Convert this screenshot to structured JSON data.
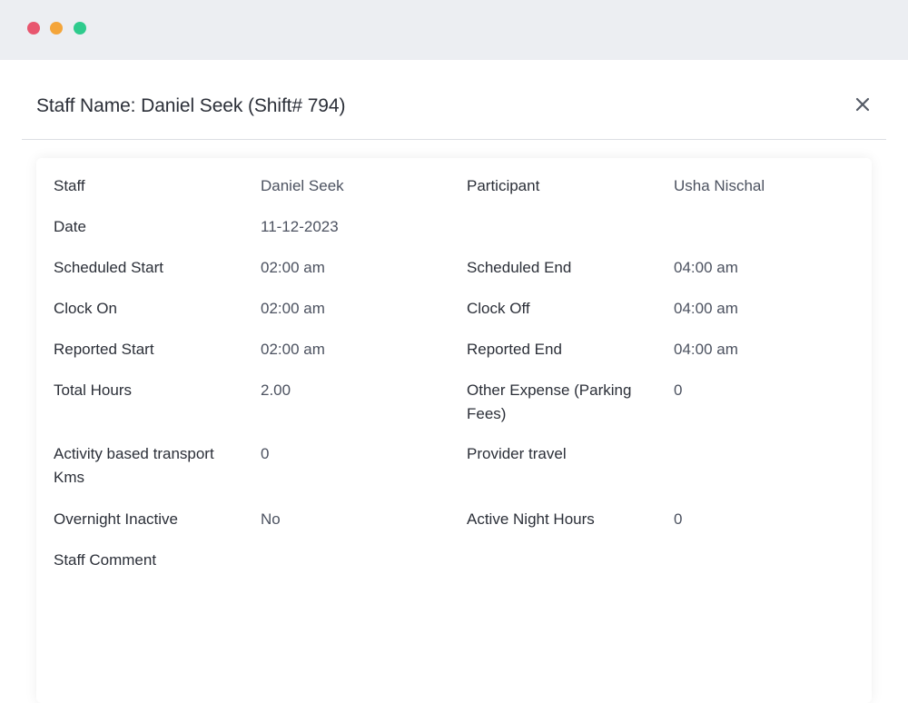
{
  "window": {
    "controls": [
      "close",
      "minimize",
      "maximize"
    ]
  },
  "modal": {
    "title": "Staff Name: Daniel Seek (Shift# 794)",
    "close_icon": "close-icon"
  },
  "details": {
    "staff_label": "Staff",
    "staff_value": "Daniel Seek",
    "participant_label": "Participant",
    "participant_value": "Usha Nischal",
    "date_label": "Date",
    "date_value": "11-12-2023",
    "scheduled_start_label": "Scheduled Start",
    "scheduled_start_value": "02:00 am",
    "scheduled_end_label": "Scheduled End",
    "scheduled_end_value": "04:00 am",
    "clock_on_label": "Clock On",
    "clock_on_value": "02:00 am",
    "clock_off_label": "Clock Off",
    "clock_off_value": "04:00 am",
    "reported_start_label": "Reported Start",
    "reported_start_value": "02:00 am",
    "reported_end_label": "Reported End",
    "reported_end_value": "04:00 am",
    "total_hours_label": "Total Hours",
    "total_hours_value": "2.00",
    "other_expense_label": "Other Expense (Parking Fees)",
    "other_expense_value": "0",
    "activity_transport_label": "Activity based transport Kms",
    "activity_transport_value": "0",
    "provider_travel_label": "Provider travel",
    "provider_travel_value": "",
    "overnight_inactive_label": "Overnight Inactive",
    "overnight_inactive_value": "No",
    "active_night_hours_label": "Active Night Hours",
    "active_night_hours_value": "0",
    "staff_comment_label": "Staff Comment",
    "staff_comment_value": ""
  },
  "colors": {
    "dot_red": "#e8566f",
    "dot_yellow": "#f4a53a",
    "dot_green": "#2ecb8d",
    "titlebar": "#eceef2"
  }
}
